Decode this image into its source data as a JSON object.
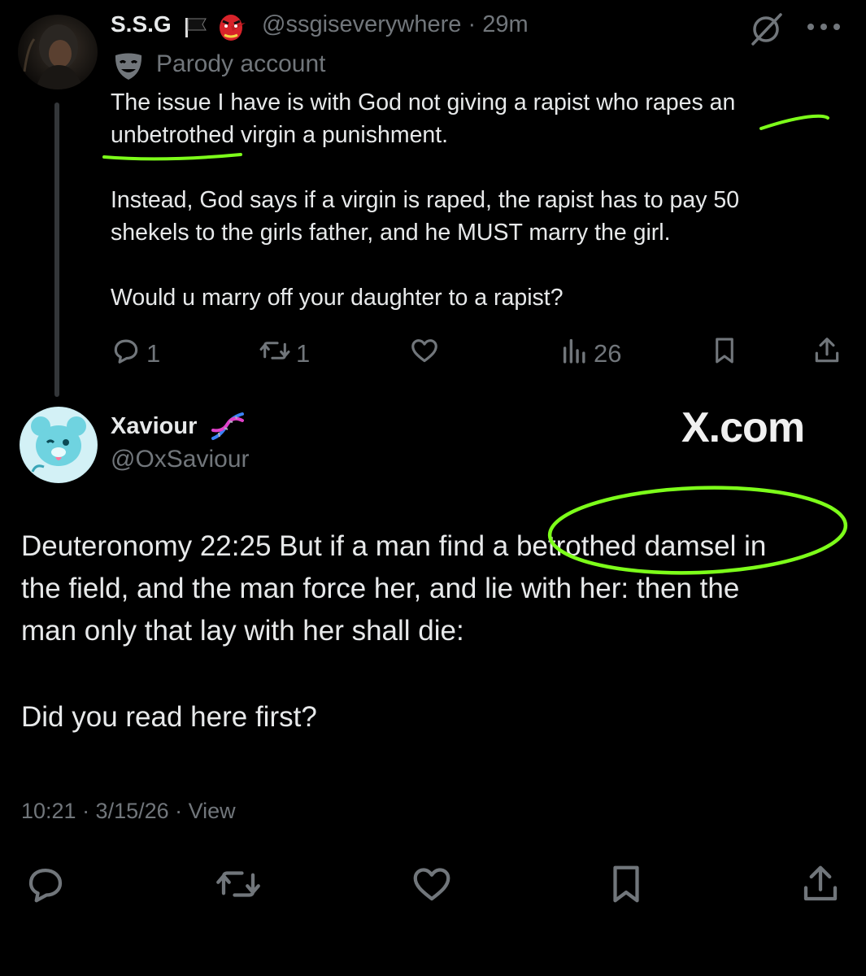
{
  "parent_tweet": {
    "display_name": "S.S.G",
    "handle": "@ssgiseverywhere",
    "separator": "·",
    "time": "29m",
    "badge_label": "Parody account",
    "text_lines": [
      "The issue I have is with God not  giving a rapist who rapes an",
      "unbetrothed  virgin a punishment.",
      "Instead, God says if a virgin is raped, the rapist has to pay 50",
      "shekels to the girls father, and he MUST marry the girl.",
      "Would u marry off your daughter to a rapist?"
    ],
    "actions": {
      "replies": "1",
      "reposts": "1",
      "views": "26"
    }
  },
  "main_tweet": {
    "display_name": "Xaviour",
    "handle": "@OxSaviour",
    "text_lines": [
      "Deuteronomy  22:25 But if a man find a betrothed damsel in",
      "the field, and the man force her, and lie with her: then the",
      "man only that lay with her shall die:",
      "Did you read here first?"
    ],
    "timestamp": "10:21 · 3/15/26 · View"
  },
  "watermark": "X.com",
  "icons": {
    "flag": "black-flag-icon",
    "mask": "tengu-mask-icon",
    "grok": "grok-icon",
    "more": "more-icon",
    "parody": "theater-mask-icon",
    "dna": "dna-icon",
    "reply": "reply-icon",
    "repost": "repost-icon",
    "like": "heart-icon",
    "views": "views-icon",
    "bookmark": "bookmark-icon",
    "share": "share-icon"
  },
  "colors": {
    "background": "#000000",
    "text_primary": "#e7e9ea",
    "text_secondary": "#71767b",
    "annotation": "#7dff1a"
  }
}
